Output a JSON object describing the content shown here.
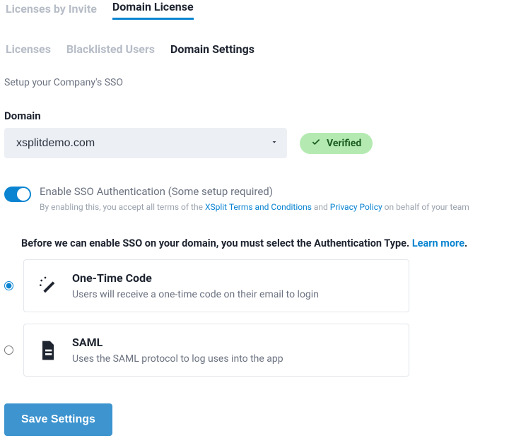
{
  "tabs_primary": {
    "licenses_by_invite": "Licenses by Invite",
    "domain_license": "Domain License"
  },
  "tabs_secondary": {
    "licenses": "Licenses",
    "blacklisted": "Blacklisted Users",
    "domain_settings": "Domain Settings"
  },
  "section_note": "Setup your Company's SSO",
  "domain_label": "Domain",
  "domain_value": "xsplitdemo.com",
  "verified_label": "Verified",
  "toggle": {
    "title": "Enable SSO Authentication (Some setup required)",
    "fineprint_prefix": "By enabling this, you accept all terms of the ",
    "terms_link": "XSplit Terms and Conditions",
    "and_word": " and ",
    "privacy_link": "Privacy Policy",
    "fineprint_suffix": " on behalf of your team"
  },
  "auth_heading": {
    "before": "Before we can enable SSO on your domain",
    "comma": ", ",
    "after": "you must select the Authentication Type. ",
    "learn_more": "Learn more",
    "dot": "."
  },
  "auth_options": {
    "otc": {
      "title": "One-Time Code",
      "desc": "Users will receive a one-time code on their email to login"
    },
    "saml": {
      "title": "SAML",
      "desc": "Uses the SAML protocol to log uses into the app"
    }
  },
  "save_button": "Save Settings"
}
